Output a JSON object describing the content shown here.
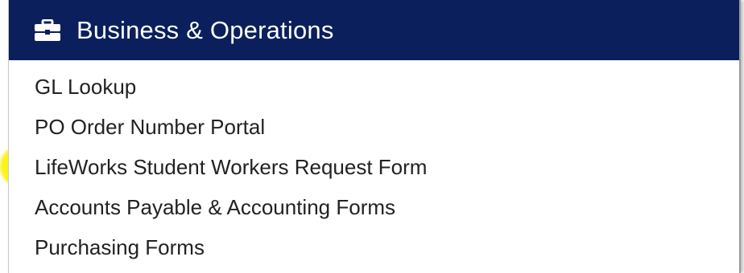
{
  "header": {
    "title": "Business & Operations",
    "icon": "briefcase-icon",
    "background_color": "#0a1f5c"
  },
  "links": [
    {
      "label": "GL Lookup"
    },
    {
      "label": "PO Order Number Portal"
    },
    {
      "label": "LifeWorks Student Workers Request Form",
      "highlighted": true
    },
    {
      "label": "Accounts Payable & Accounting Forms"
    },
    {
      "label": "Purchasing Forms"
    }
  ],
  "highlight_color": "#fcf21d"
}
